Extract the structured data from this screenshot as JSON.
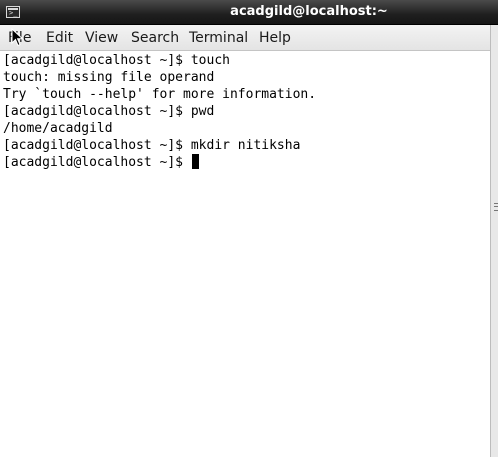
{
  "window": {
    "title": "acadgild@localhost:~",
    "icon": "terminal-icon"
  },
  "menu": {
    "file": "File",
    "edit": "Edit",
    "view": "View",
    "search": "Search",
    "terminal": "Terminal",
    "help": "Help"
  },
  "terminal": {
    "lines": [
      "[acadgild@localhost ~]$ touch",
      "touch: missing file operand",
      "Try `touch --help' for more information.",
      "[acadgild@localhost ~]$ pwd",
      "/home/acadgild",
      "[acadgild@localhost ~]$ mkdir nitiksha",
      "[acadgild@localhost ~]$ "
    ]
  },
  "colors": {
    "titlebar": "#1f1f1f",
    "menubar": "#e9e9e9",
    "terminal_bg": "#ffffff",
    "terminal_fg": "#000000"
  }
}
